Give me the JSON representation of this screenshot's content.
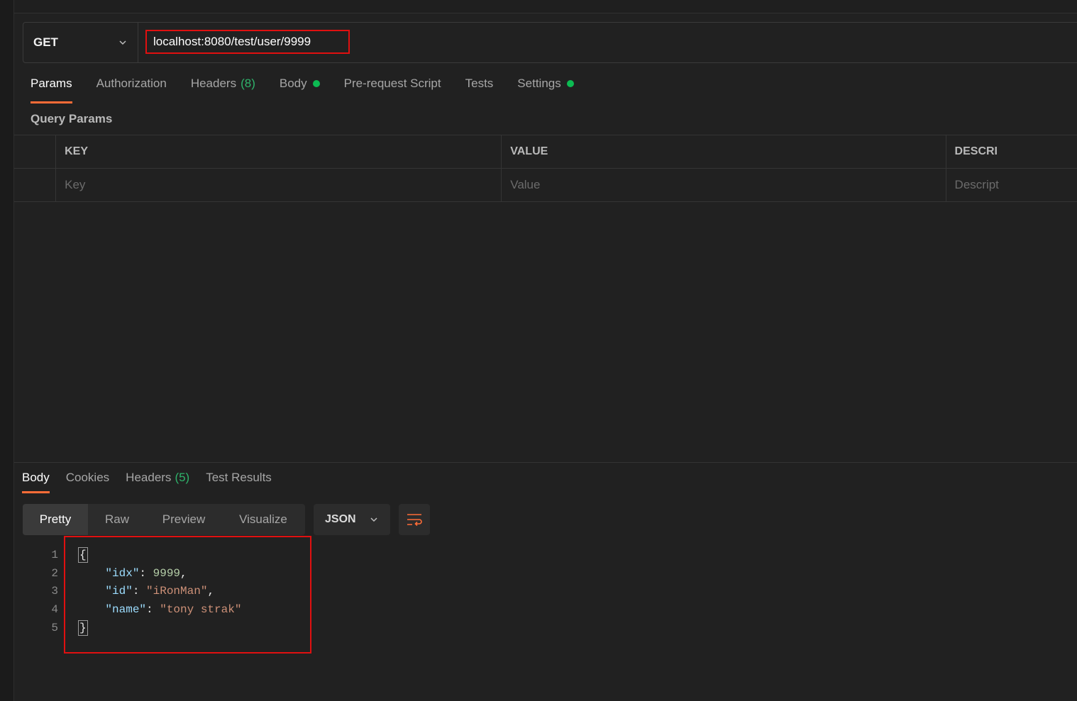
{
  "request": {
    "method": "GET",
    "url": "localhost:8080/test/user/9999"
  },
  "request_tabs": [
    {
      "label": "Params",
      "active": true
    },
    {
      "label": "Authorization"
    },
    {
      "label": "Headers",
      "count": "(8)"
    },
    {
      "label": "Body",
      "dot": true
    },
    {
      "label": "Pre-request Script"
    },
    {
      "label": "Tests"
    },
    {
      "label": "Settings",
      "dot": true
    }
  ],
  "query_params": {
    "title": "Query Params",
    "headers": [
      "KEY",
      "VALUE",
      "DESCRI"
    ],
    "placeholders": [
      "Key",
      "Value",
      "Descript"
    ]
  },
  "response_tabs": [
    {
      "label": "Body",
      "active": true
    },
    {
      "label": "Cookies"
    },
    {
      "label": "Headers",
      "count": "(5)"
    },
    {
      "label": "Test Results"
    }
  ],
  "view_modes": [
    "Pretty",
    "Raw",
    "Preview",
    "Visualize"
  ],
  "active_view": "Pretty",
  "format": "JSON",
  "response_body": {
    "line_numbers": [
      "1",
      "2",
      "3",
      "4",
      "5"
    ],
    "open_brace": "{",
    "close_brace": "}",
    "fields": [
      {
        "key": "\"idx\"",
        "value": "9999",
        "type": "number",
        "trail": ","
      },
      {
        "key": "\"id\"",
        "value": "\"iRonMan\"",
        "type": "string",
        "trail": ","
      },
      {
        "key": "\"name\"",
        "value": "\"tony strak\"",
        "type": "string",
        "trail": ""
      }
    ]
  },
  "colors": {
    "accent": "#ff6c37",
    "highlight_box": "#e01010",
    "status_dot": "#0cbb52",
    "count": "#2fb36b",
    "json_key": "#9cdcfe",
    "json_string": "#ce9178",
    "json_number": "#b5cea8"
  }
}
